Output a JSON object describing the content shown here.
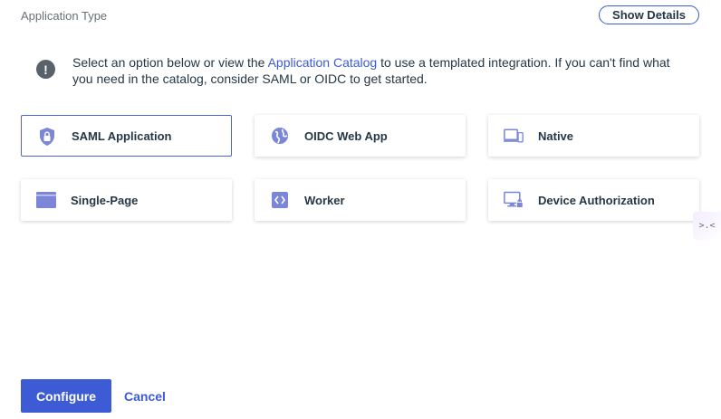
{
  "header": {
    "title": "Application Type",
    "show_details_label": "Show Details"
  },
  "info": {
    "icon_glyph": "!",
    "text_before": "Select an option below or view the ",
    "link_text": "Application Catalog",
    "text_after": " to use a templated integration. If you can't find what you need in the catalog, consider SAML or OIDC to get started."
  },
  "options": [
    {
      "label": "SAML Application",
      "icon": "shield-lock-icon",
      "selected": true
    },
    {
      "label": "OIDC Web App",
      "icon": "globe-icon",
      "selected": false
    },
    {
      "label": "Native",
      "icon": "devices-icon",
      "selected": false
    },
    {
      "label": "Single-Page",
      "icon": "browser-window-icon",
      "selected": false
    },
    {
      "label": "Worker",
      "icon": "code-icon",
      "selected": false
    },
    {
      "label": "Device Authorization",
      "icon": "monitor-lock-icon",
      "selected": false
    }
  ],
  "side_widget": {
    "glyph": ">.<"
  },
  "footer": {
    "configure_label": "Configure",
    "cancel_label": "Cancel"
  },
  "colors": {
    "accent": "#3c5bd5",
    "icon": "#7b86d8",
    "text": "#253746"
  }
}
